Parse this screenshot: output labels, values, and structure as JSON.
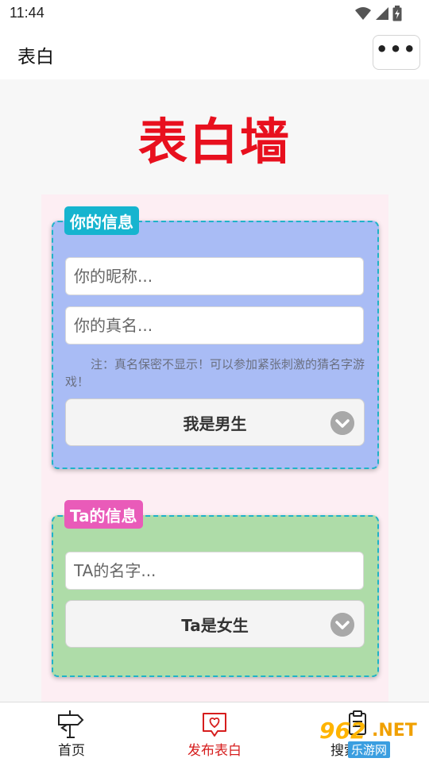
{
  "status_bar": {
    "time": "11:44"
  },
  "header": {
    "title": "表白",
    "menu_icon": "more-dots-icon"
  },
  "wall": {
    "title": "表白墙"
  },
  "my_info": {
    "legend": "你的信息",
    "nickname_placeholder": "你的昵称...",
    "realname_placeholder": "你的真名...",
    "note": "注：真名保密不显示！可以参加紧张刺激的猜名字游戏！",
    "gender_selected": "我是男生"
  },
  "ta_info": {
    "legend": "Ta的信息",
    "name_placeholder": "TA的名字...",
    "gender_selected": "Ta是女生"
  },
  "tab_bar": {
    "items": [
      {
        "label": "首页",
        "icon": "signpost-icon"
      },
      {
        "label": "发布表白",
        "icon": "heart-message-icon"
      },
      {
        "label": "搜索表白",
        "icon": "clipboard-icon"
      }
    ]
  },
  "watermark": {
    "brand": "962",
    "tld": ".NET",
    "subtitle": "乐游网"
  },
  "colors": {
    "title_red": "#e8101e",
    "my_card_bg": "#a9bcf5",
    "ta_card_bg": "#aedca8",
    "my_legend_bg": "#16b4cf",
    "ta_legend_bg": "#e95bb9",
    "active_tab": "#d61d1d"
  }
}
